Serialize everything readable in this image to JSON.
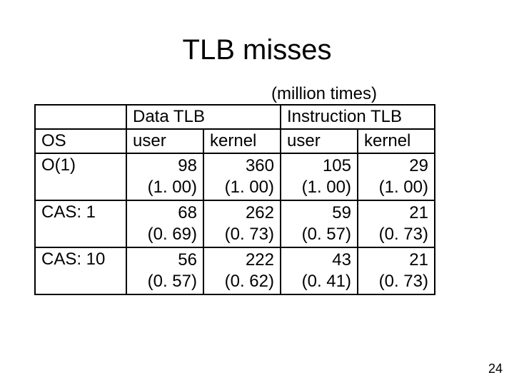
{
  "title": "TLB misses",
  "units": "(million times)",
  "group_headers": {
    "blank": "",
    "data_tlb": "Data TLB",
    "instr_tlb": "Instruction TLB"
  },
  "col_headers": {
    "os": "OS",
    "d_user": "user",
    "d_kernel": "kernel",
    "i_user": "user",
    "i_kernel": "kernel"
  },
  "rows": [
    {
      "os": "O(1)",
      "d_user_v": "98",
      "d_user_r": "(1. 00)",
      "d_kern_v": "360",
      "d_kern_r": "(1. 00)",
      "i_user_v": "105",
      "i_user_r": "(1. 00)",
      "i_kern_v": "29",
      "i_kern_r": "(1. 00)"
    },
    {
      "os": "CAS: 1",
      "d_user_v": "68",
      "d_user_r": "(0. 69)",
      "d_kern_v": "262",
      "d_kern_r": "(0. 73)",
      "i_user_v": "59",
      "i_user_r": "(0. 57)",
      "i_kern_v": "21",
      "i_kern_r": "(0. 73)"
    },
    {
      "os": "CAS: 10",
      "d_user_v": "56",
      "d_user_r": "(0. 57)",
      "d_kern_v": "222",
      "d_kern_r": "(0. 62)",
      "i_user_v": "43",
      "i_user_r": "(0. 41)",
      "i_kern_v": "21",
      "i_kern_r": "(0. 73)"
    }
  ],
  "page_number": "24",
  "chart_data": {
    "type": "table",
    "title": "TLB misses (million times)",
    "columns": [
      "OS",
      "Data TLB user",
      "Data TLB kernel",
      "Instruction TLB user",
      "Instruction TLB kernel"
    ],
    "rows": [
      {
        "os": "O(1)",
        "data_user": 98,
        "data_user_ratio": 1.0,
        "data_kernel": 360,
        "data_kernel_ratio": 1.0,
        "instr_user": 105,
        "instr_user_ratio": 1.0,
        "instr_kernel": 29,
        "instr_kernel_ratio": 1.0
      },
      {
        "os": "CAS: 1",
        "data_user": 68,
        "data_user_ratio": 0.69,
        "data_kernel": 262,
        "data_kernel_ratio": 0.73,
        "instr_user": 59,
        "instr_user_ratio": 0.57,
        "instr_kernel": 21,
        "instr_kernel_ratio": 0.73
      },
      {
        "os": "CAS: 10",
        "data_user": 56,
        "data_user_ratio": 0.57,
        "data_kernel": 222,
        "data_kernel_ratio": 0.62,
        "instr_user": 43,
        "instr_user_ratio": 0.41,
        "instr_kernel": 21,
        "instr_kernel_ratio": 0.73
      }
    ]
  }
}
